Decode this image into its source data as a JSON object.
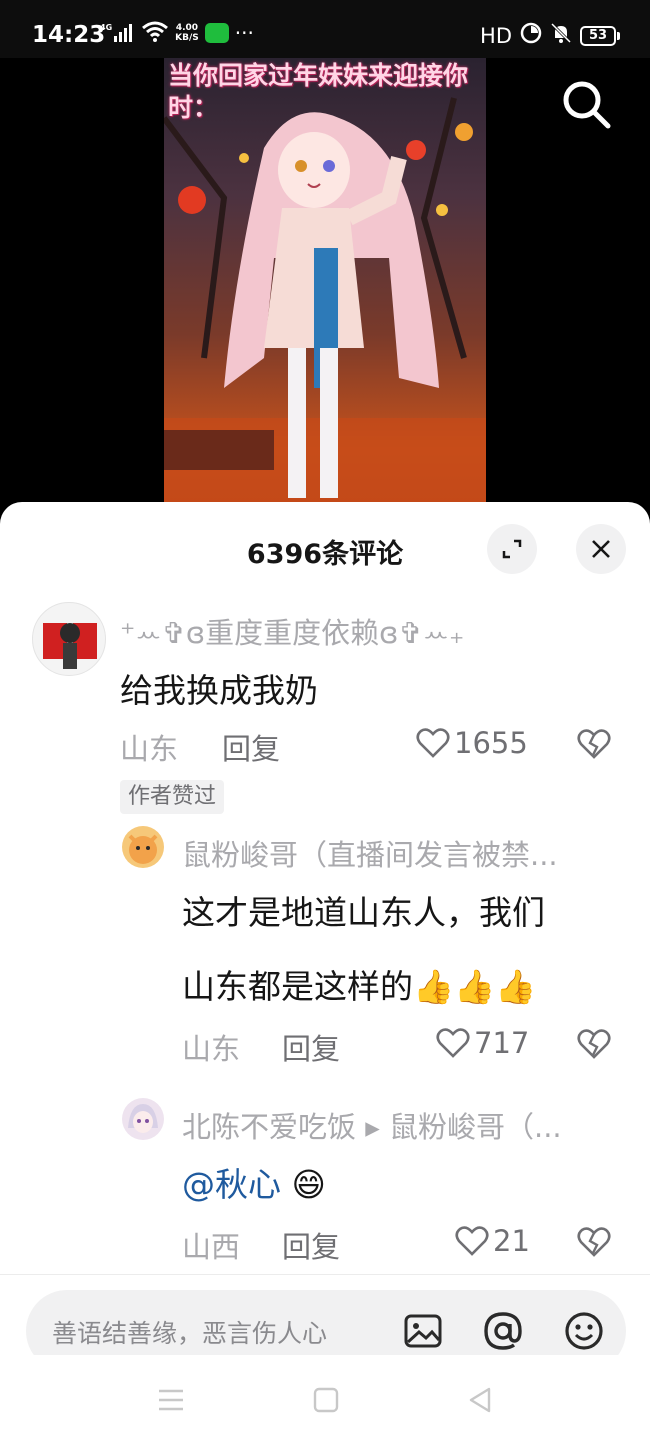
{
  "status_bar": {
    "time": "14:23",
    "network_type": "4G",
    "speed_value": "4.00",
    "speed_unit": "KB/S",
    "dots": "···",
    "hd_label": "HD",
    "battery": "53",
    "icons": [
      "signal-icon",
      "wifi-icon",
      "wechat-icon",
      "hd-icon",
      "data-saver-icon",
      "bell-off-icon",
      "battery-icon"
    ]
  },
  "video": {
    "caption": "当你回家过年妹妹来迎接你时："
  },
  "comments_sheet": {
    "title": "6396条评论"
  },
  "comments": [
    {
      "username": "⁺ꕀ✞ɞ重度重度依赖ɞ✞ꕀ₊",
      "text": "给我换成我奶",
      "location": "山东",
      "reply_label": "回复",
      "likes": "1655",
      "author_badge": "作者赞过",
      "replies": [
        {
          "username": "鼠粉峻哥（直播间发言被禁...",
          "text_line1": "这才是地道山东人，我们",
          "text_line2": "山东都是这样的👍👍👍",
          "location": "山东",
          "reply_label": "回复",
          "likes": "717"
        },
        {
          "username": "北陈不爱吃饭 ▸ 鼠粉峻哥（...",
          "mention": "@秋心",
          "emoji": "😄",
          "location": "山西",
          "reply_label": "回复",
          "likes": "21"
        }
      ]
    }
  ],
  "input": {
    "placeholder": "善语结善缘，恶言伤人心"
  },
  "colors": {
    "accent_mention": "#1f5a9e",
    "text_primary": "#161616",
    "text_secondary": "#a9a9ad",
    "sheet_bg": "#ffffff"
  }
}
